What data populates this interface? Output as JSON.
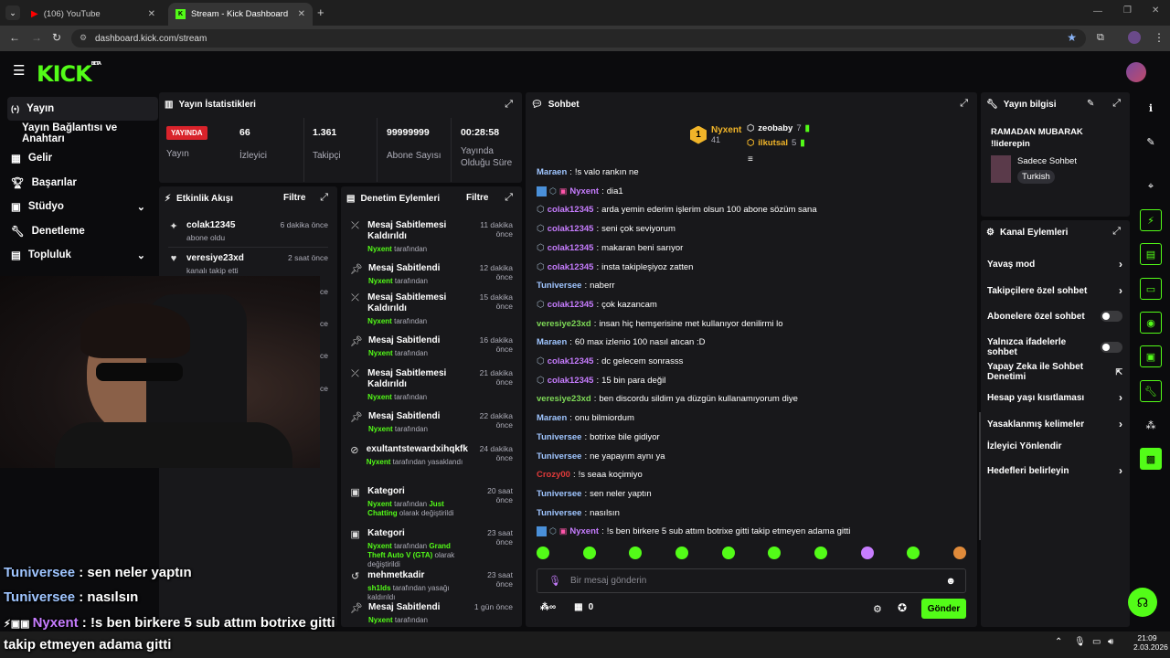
{
  "browser": {
    "tabs": [
      {
        "label": "(106) YouTube"
      },
      {
        "label": "Stream - Kick Dashboard"
      }
    ],
    "url": "dashboard.kick.com/stream"
  },
  "header": {
    "logo": "KICK",
    "beta": "BETA"
  },
  "sidebar": {
    "items": [
      {
        "label": "Yayın"
      },
      {
        "label": "Yayın Bağlantısı ve Anahtarı"
      },
      {
        "label": "Gelir"
      },
      {
        "label": "Başarılar"
      },
      {
        "label": "Stüdyo"
      },
      {
        "label": "Denetleme"
      },
      {
        "label": "Topluluk"
      }
    ]
  },
  "stats": {
    "title": "Yayın İstatistikleri",
    "live": "YAYINDA",
    "items": [
      {
        "value": "",
        "label": "Yayın"
      },
      {
        "value": "66",
        "label": "İzleyici"
      },
      {
        "value": "1.361",
        "label": "Takipçi"
      },
      {
        "value": "99999999",
        "label": "Abone Sayısı"
      },
      {
        "value": "00:28:58",
        "label": "Yayında Olduğu Süre"
      }
    ]
  },
  "activity": {
    "title": "Etkinlik Akışı",
    "filter": "Filtre",
    "items": [
      {
        "user": "colak12345",
        "text": "abone oldu",
        "time": "6 dakika önce"
      },
      {
        "user": "veresiye23xd",
        "text": "kanalı takip etti",
        "time": "2 saat önce"
      }
    ],
    "partial_times": [
      "ce",
      "ce",
      "ce",
      "ce"
    ]
  },
  "moderation": {
    "title": "Denetim Eylemleri",
    "filter": "Filtre",
    "items": [
      {
        "title": "Mesaj Sabitlemesi Kaldırıldı",
        "by": "Nyxent",
        "rest": "tarafından",
        "time": "11 dakika önce"
      },
      {
        "title": "Mesaj Sabitlendi",
        "by": "Nyxent",
        "rest": "tarafından",
        "time": "12 dakika önce"
      },
      {
        "title": "Mesaj Sabitlemesi Kaldırıldı",
        "by": "Nyxent",
        "rest": "tarafından",
        "time": "15 dakika önce"
      },
      {
        "title": "Mesaj Sabitlendi",
        "by": "Nyxent",
        "rest": "tarafından",
        "time": "16 dakika önce"
      },
      {
        "title": "Mesaj Sabitlemesi Kaldırıldı",
        "by": "Nyxent",
        "rest": "tarafından",
        "time": "21 dakika önce"
      },
      {
        "title": "Mesaj Sabitlendi",
        "by": "Nyxent",
        "rest": "tarafından",
        "time": "22 dakika önce"
      },
      {
        "title": "exultantstewardxihqkfk",
        "by": "Nyxent",
        "rest": "tarafından yasaklandı",
        "time": "24 dakika önce"
      },
      {
        "title": "Kategori",
        "by": "Nyxent",
        "rest": "tarafından",
        "extra": "Just Chatting",
        "rest2": "olarak değiştirildi",
        "time": "20 saat önce"
      },
      {
        "title": "Kategori",
        "by": "Nyxent",
        "rest": "tarafından",
        "extra": "Grand Theft Auto V (GTA)",
        "rest2": "olarak değiştirildi",
        "time": "23 saat önce"
      },
      {
        "title": "mehmetkadir",
        "by": "sh1lds",
        "rest": "tarafından yasağı kaldırıldı",
        "time": "23 saat önce"
      },
      {
        "title": "Mesaj Sabitlendi",
        "by": "Nyxent",
        "rest": "tarafından",
        "time": "1 gün önce"
      }
    ]
  },
  "chat": {
    "title": "Sohbet",
    "leaders": [
      {
        "rank": "1",
        "name": "Nyxent",
        "count": "41"
      },
      {
        "name": "zeobaby",
        "count": "7"
      },
      {
        "name": "ilkutsal",
        "count": "5"
      }
    ],
    "messages": [
      {
        "user": "Maraen",
        "color": "#9fc5ff",
        "text": "!s valo rankın ne"
      },
      {
        "user": "Nyxent",
        "color": "#c77dff",
        "text": "dia1",
        "badges": 3
      },
      {
        "user": "colak12345",
        "color": "#c77dff",
        "text": "arda yemin ederim işlerim olsun 100 abone sözüm sana",
        "badges": 1
      },
      {
        "user": "colak12345",
        "color": "#c77dff",
        "text": "seni çok seviyorum",
        "badges": 1
      },
      {
        "user": "colak12345",
        "color": "#c77dff",
        "text": "makaran beni sarıyor",
        "badges": 1
      },
      {
        "user": "colak12345",
        "color": "#c77dff",
        "text": "insta takipleşiyoz zatten",
        "badges": 1
      },
      {
        "user": "Tuniversee",
        "color": "#9fc5ff",
        "text": "naberr"
      },
      {
        "user": "colak12345",
        "color": "#c77dff",
        "text": "çok kazancam",
        "badges": 1
      },
      {
        "user": "veresiye23xd",
        "color": "#7ed957",
        "text": "insan hiç hemşerisine met kullanıyor denilirmi lo"
      },
      {
        "user": "Maraen",
        "color": "#9fc5ff",
        "text": "60 max izlenio 100 nasıl atıcan :D"
      },
      {
        "user": "colak12345",
        "color": "#c77dff",
        "text": "dc gelecem sonrasss",
        "badges": 1
      },
      {
        "user": "colak12345",
        "color": "#c77dff",
        "text": "15 bin para değil",
        "badges": 1
      },
      {
        "user": "veresiye23xd",
        "color": "#7ed957",
        "text": "ben discordu sildim ya düzgün kullanamıyorum diye"
      },
      {
        "user": "Maraen",
        "color": "#9fc5ff",
        "text": "onu bilmiordum"
      },
      {
        "user": "Tuniversee",
        "color": "#9fc5ff",
        "text": "botrixe bile gidiyor"
      },
      {
        "user": "Tuniversee",
        "color": "#9fc5ff",
        "text": "ne yapayım aynı ya"
      },
      {
        "user": "Crozy00",
        "color": "#e03a3a",
        "text": "!s seaa koçimiyo"
      },
      {
        "user": "Tuniversee",
        "color": "#9fc5ff",
        "text": "sen neler yaptın"
      },
      {
        "user": "Tuniversee",
        "color": "#9fc5ff",
        "text": "nasılsın"
      },
      {
        "user": "Nyxent",
        "color": "#c77dff",
        "text": "!s ben birkere 5 sub attım botrixe gitti takip etmeyen adama gitti",
        "badges": 3
      }
    ],
    "input_placeholder": "Bir mesaj gönderin",
    "points": "0",
    "send": "Gönder"
  },
  "stream_info": {
    "title": "Yayın bilgisi",
    "stream_title": "RAMADAN MUBARAK !liderepin",
    "category": "Sadece Sohbet",
    "language": "Turkish"
  },
  "channel_actions": {
    "title": "Kanal Eylemleri",
    "items": [
      {
        "label": "Yavaş mod",
        "kind": "chevron"
      },
      {
        "label": "Takipçilere özel sohbet",
        "kind": "chevron"
      },
      {
        "label": "Abonelere özel sohbet",
        "kind": "toggle"
      },
      {
        "label": "Yalnızca ifadelerle sohbet",
        "kind": "toggle"
      },
      {
        "label": "Yapay Zeka ile Sohbet Denetimi",
        "kind": "external"
      },
      {
        "label": "Hesap yaşı kısıtlaması",
        "kind": "chevron"
      },
      {
        "label": "Yasaklanmış kelimeler",
        "kind": "chevron"
      },
      {
        "label": "İzleyici Yönlendir",
        "kind": "none"
      },
      {
        "label": "Hedefleri belirleyin",
        "kind": "chevron"
      }
    ]
  },
  "overlay": {
    "lines": [
      {
        "user": "Tuniversee",
        "text": " : sen neler yaptın"
      },
      {
        "user": "Tuniversee",
        "text": " : nasılsın"
      },
      {
        "user": "Nyxent",
        "text": " : !s ben birkere 5 sub attım botrixe gitti"
      },
      {
        "user": "",
        "text": "takip etmeyen adama gitti"
      }
    ]
  },
  "taskbar": {
    "time": "21:09",
    "date": "2.03.2026"
  },
  "colors": {
    "accent": "#53fc18",
    "live": "#d9232b",
    "panel": "#18181b",
    "bg": "#0b0b0d"
  }
}
